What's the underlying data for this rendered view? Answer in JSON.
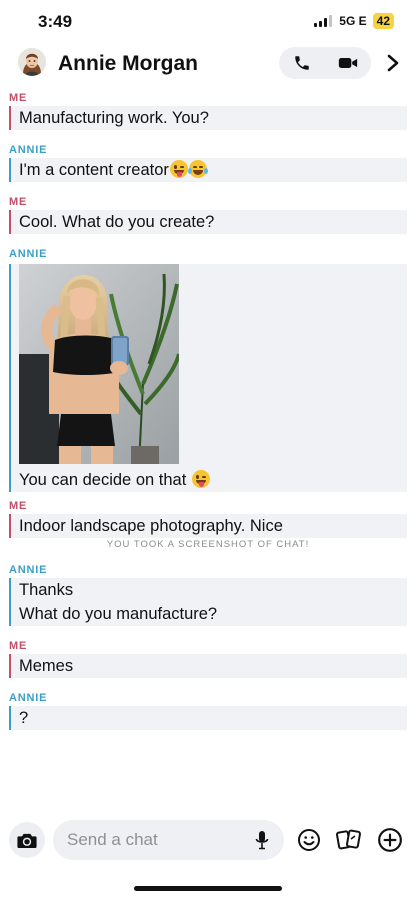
{
  "status_bar": {
    "time": "3:49",
    "network": "5G E",
    "battery": "42"
  },
  "header": {
    "contact_name": "Annie Morgan",
    "avatar_icon": "bitmoji-avatar-icon",
    "call_icon": "phone-icon",
    "video_icon": "video-camera-icon",
    "more_icon": "chevron-right-icon"
  },
  "chat": {
    "sender_me": "ME",
    "sender_annie": "ANNIE",
    "messages": [
      {
        "sender": "ME",
        "lines": [
          "Manufacturing work. You?"
        ]
      },
      {
        "sender": "ANNIE",
        "lines": [
          "I'm a content creator"
        ],
        "emojis": [
          "winking-tongue-emoji",
          "laughing-tears-emoji"
        ]
      },
      {
        "sender": "ME",
        "lines": [
          "Cool. What do you create?"
        ]
      },
      {
        "sender": "ANNIE",
        "has_photo": true,
        "lines": [
          "You can decide on that"
        ],
        "emojis": [
          "winking-tongue-emoji"
        ]
      },
      {
        "sender": "ME",
        "lines": [
          "Indoor landscape photography. Nice"
        ]
      },
      {
        "sender": "ANNIE",
        "lines": [
          "Thanks",
          "What do you manufacture?"
        ]
      },
      {
        "sender": "ME",
        "lines": [
          "Memes"
        ]
      },
      {
        "sender": "ANNIE",
        "lines": [
          "?"
        ]
      }
    ],
    "screenshot_notice": "YOU TOOK A SCREENSHOT OF CHAT!"
  },
  "colors": {
    "me_accent": "#c0506a",
    "annie_accent": "#3a9fc6",
    "message_bg": "#f1f2f6",
    "battery_bg": "#f6d440"
  },
  "bottom_bar": {
    "placeholder": "Send a chat",
    "camera_icon": "camera-icon",
    "mic_icon": "microphone-icon",
    "emoji_icon": "smiley-icon",
    "sticker_icon": "sticker-cards-icon",
    "add_icon": "plus-circle-icon"
  }
}
